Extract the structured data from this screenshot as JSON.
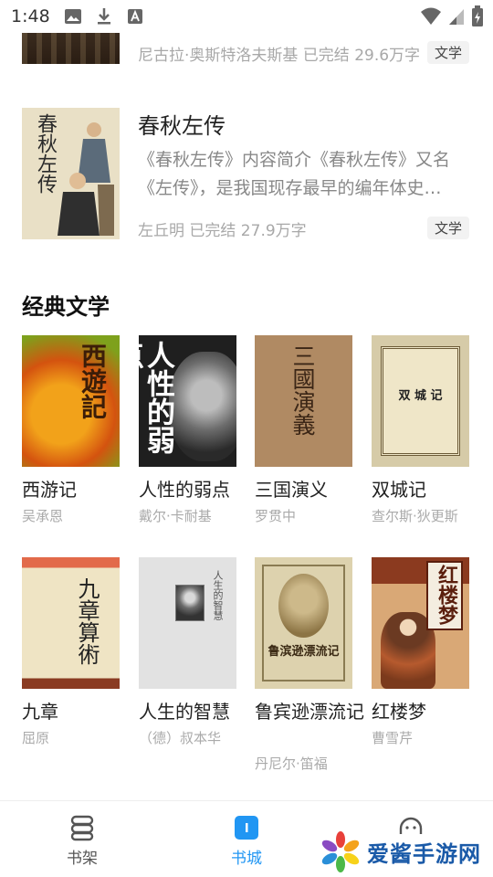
{
  "status_bar": {
    "time": "1:48",
    "icons": [
      "image-icon",
      "download-icon",
      "a-icon",
      "wifi-icon",
      "signal-icon",
      "battery-icon"
    ]
  },
  "prev_book": {
    "meta": "尼古拉·奥斯特洛夫斯基 已完结 29.6万字",
    "tag": "文学"
  },
  "featured_book": {
    "title": "春秋左传",
    "cover_title": "春秋左传",
    "description": "《春秋左传》内容简介《春秋左传》又名《左传》，是我国现存最早的编年体史…",
    "meta": "左丘明 已完结 27.9万字",
    "tag": "文学"
  },
  "section": {
    "title": "经典文学"
  },
  "books": [
    {
      "title": "西游记",
      "author": "吴承恩",
      "cover_text": "西遊記"
    },
    {
      "title": "人性的弱点",
      "author": "戴尔·卡耐基",
      "cover_text": "人性的弱点"
    },
    {
      "title": "三国演义",
      "author": "罗贯中",
      "cover_text": "三國演義"
    },
    {
      "title": "双城记",
      "author": "查尔斯·狄更斯",
      "cover_text": "双 城 记"
    },
    {
      "title": "九章",
      "author": "屈原",
      "cover_text": "九章算術"
    },
    {
      "title": "人生的智慧",
      "author": "（德）叔本华",
      "cover_text": "人生的智慧"
    },
    {
      "title": "鲁宾逊漂流记",
      "author": "丹尼尔·笛福",
      "cover_text": "鲁滨逊漂流记"
    },
    {
      "title": "红楼梦",
      "author": "曹雪芹",
      "cover_text": "红楼梦"
    }
  ],
  "bottom_nav": {
    "items": [
      {
        "label": "书架",
        "active": false
      },
      {
        "label": "书城",
        "active": true
      },
      {
        "label": "",
        "active": false
      }
    ]
  },
  "watermark": {
    "text": "爱酱手游网"
  },
  "colors": {
    "accent": "#2196f3",
    "muted": "#a8a8a8",
    "watermark": "#1a5aa8"
  }
}
